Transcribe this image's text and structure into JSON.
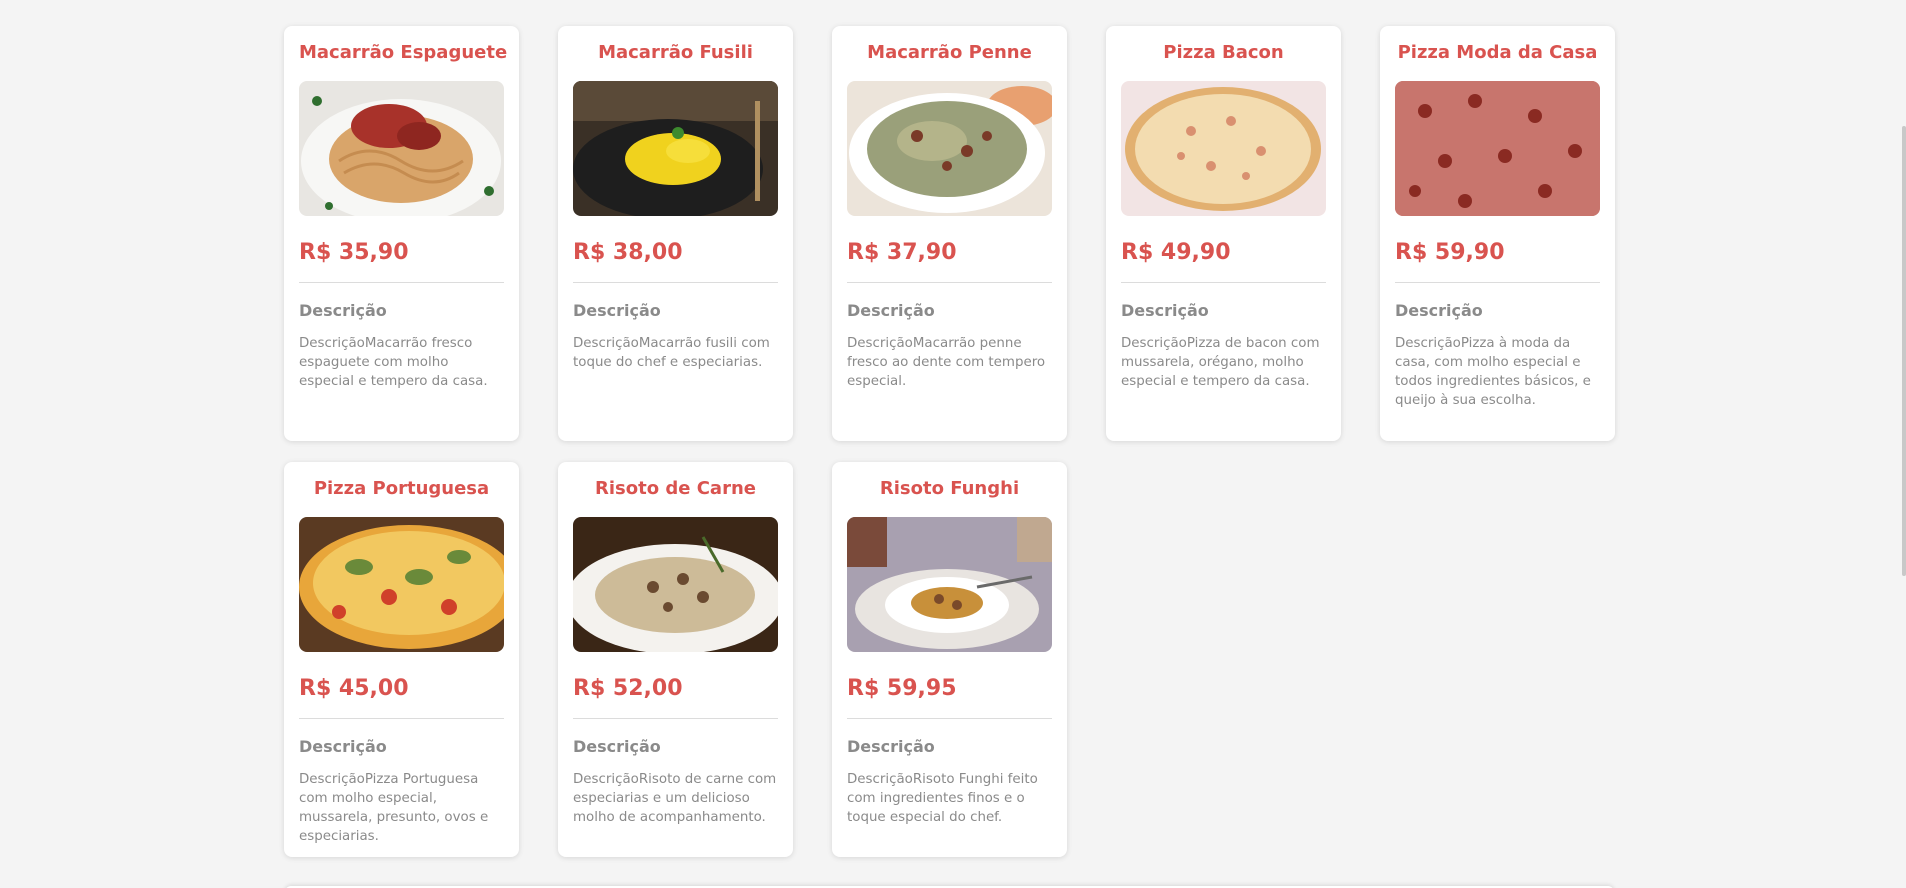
{
  "menu": {
    "desc_heading": "Descrição",
    "items": [
      {
        "title": "Macarrão Espaguete",
        "price": "R$ 35,90",
        "description": "DescriçãoMacarrão fresco espaguete com molho especial e tempero da casa.",
        "image": "spaghetti-photo"
      },
      {
        "title": "Macarrão Fusili",
        "price": "R$ 38,00",
        "description": "DescriçãoMacarrão fusili com toque do chef e especiarias.",
        "image": "fusili-photo"
      },
      {
        "title": "Macarrão Penne",
        "price": "R$ 37,90",
        "description": "DescriçãoMacarrão penne fresco ao dente com tempero especial.",
        "image": "penne-photo"
      },
      {
        "title": "Pizza Bacon",
        "price": "R$ 49,90",
        "description": "DescriçãoPizza de bacon com mussarela, orégano, molho especial e tempero da casa.",
        "image": "bacon-pizza-photo"
      },
      {
        "title": "Pizza Moda da Casa",
        "price": "R$ 59,90",
        "description": "DescriçãoPizza à moda da casa, com molho especial e todos ingredientes básicos, e queijo à sua escolha.",
        "image": "house-pizza-photo"
      },
      {
        "title": "Pizza Portuguesa",
        "price": "R$ 45,00",
        "description": "DescriçãoPizza Portuguesa com molho especial, mussarela, presunto, ovos e especiarias.",
        "image": "portuguesa-pizza-photo"
      },
      {
        "title": "Risoto de Carne",
        "price": "R$ 52,00",
        "description": "DescriçãoRisoto de carne com especiarias e um delicioso molho de acompanhamento.",
        "image": "meat-risotto-photo"
      },
      {
        "title": "Risoto Funghi",
        "price": "R$ 59,95",
        "description": "DescriçãoRisoto Funghi feito com ingredientes finos e o toque especial do chef.",
        "image": "funghi-risotto-photo"
      }
    ]
  },
  "colors": {
    "accent": "#d9534f",
    "muted_text": "#8a8a8a",
    "background": "#f4f4f4",
    "card": "#ffffff"
  }
}
